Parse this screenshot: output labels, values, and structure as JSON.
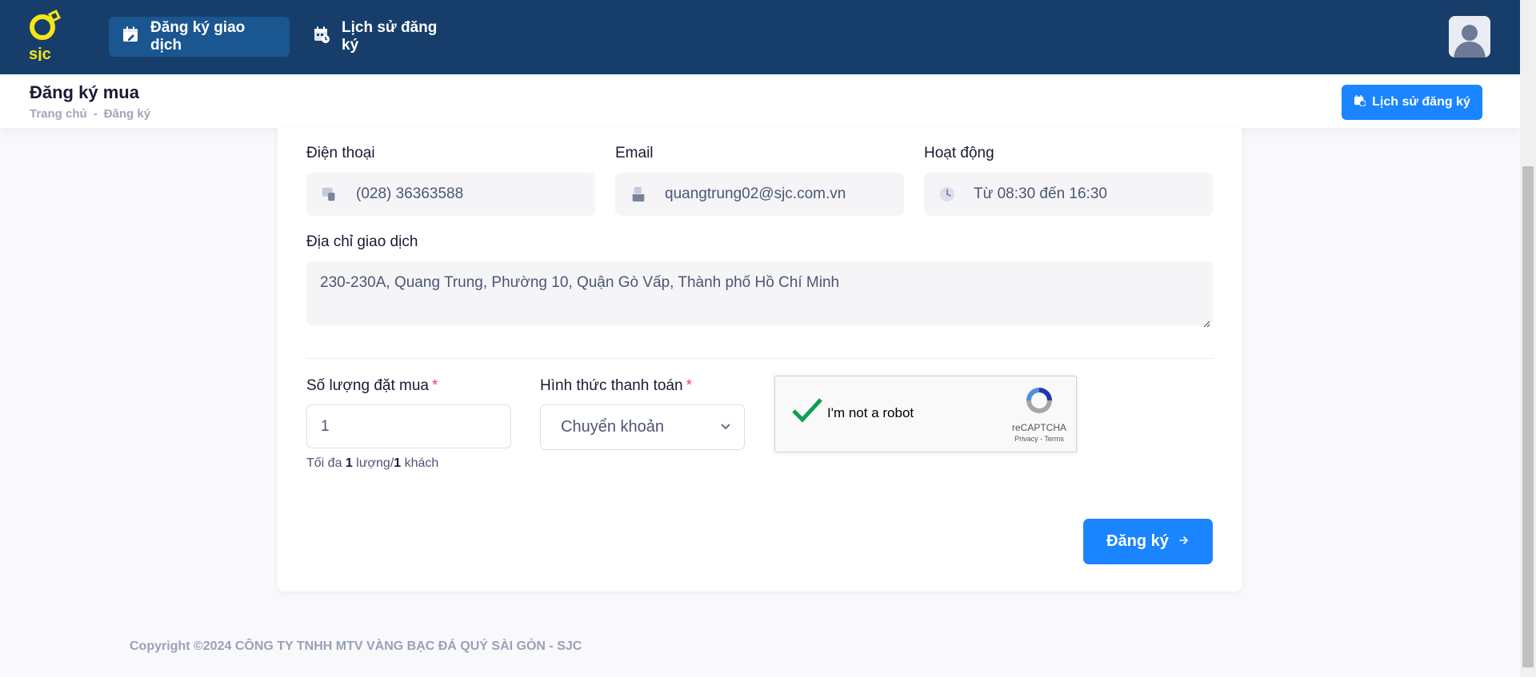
{
  "header": {
    "logo_text": "sjc",
    "nav": [
      {
        "label": "Đăng ký giao dịch",
        "active": true,
        "icon": "calendar-edit-icon"
      },
      {
        "label": "Lịch sử đăng ký",
        "active": false,
        "icon": "calendar-history-icon"
      }
    ],
    "avatar_icon": "user-avatar-icon"
  },
  "toolbar": {
    "title": "Đăng ký mua",
    "breadcrumb": [
      "Trang chủ",
      "Đăng ký"
    ],
    "history_button": "Lịch sử đăng ký"
  },
  "form": {
    "phone": {
      "label": "Điện thoại",
      "value": "(028) 36363588",
      "icon": "phone-icon"
    },
    "email": {
      "label": "Email",
      "value": "quangtrung02@sjc.com.vn",
      "icon": "mailbox-icon"
    },
    "hours": {
      "label": "Hoạt động",
      "value": "Từ 08:30 đến 16:30",
      "icon": "clock-icon"
    },
    "address": {
      "label": "Địa chỉ giao dịch",
      "value": "230-230A, Quang Trung, Phường 10, Quận Gò Vấp, Thành phố Hồ Chí Minh"
    },
    "quantity": {
      "label": "Số lượng đặt mua",
      "required": "*",
      "value": "1",
      "hint_prefix": "Tối đa ",
      "hint_qty": "1",
      "hint_mid": " lượng/",
      "hint_per": "1",
      "hint_suffix": " khách"
    },
    "payment": {
      "label": "Hình thức thanh toán",
      "required": "*",
      "value": "Chuyển khoản"
    },
    "recaptcha": {
      "label": "I'm not a robot",
      "brand": "reCAPTCHA",
      "terms": "Privacy - Terms",
      "checked": true
    },
    "submit": "Đăng ký"
  },
  "footer": {
    "copyright": "Copyright ©2024 CÔNG TY TNHH MTV VÀNG BẠC ĐÁ QUÝ SÀI GÒN - SJC"
  },
  "colors": {
    "navbar": "#173e6b",
    "nav_active": "#1a5690",
    "primary": "#1b84ff",
    "required": "#f1416c",
    "logo_yellow": "#f5e616"
  }
}
